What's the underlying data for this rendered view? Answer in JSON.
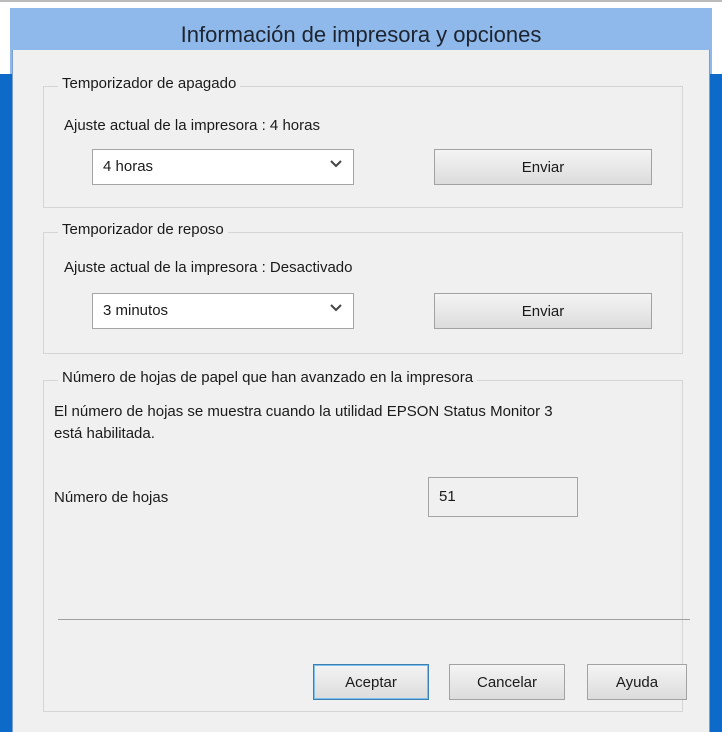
{
  "window": {
    "title": "Información de impresora y opciones"
  },
  "power_off": {
    "legend": "Temporizador de apagado",
    "current_setting": "Ajuste actual de la impresora : 4 horas",
    "selected": "4 horas",
    "send_label": "Enviar"
  },
  "sleep": {
    "legend": "Temporizador de reposo",
    "current_setting": "Ajuste actual de la impresora : Desactivado",
    "selected": "3 minutos",
    "send_label": "Enviar"
  },
  "sheets": {
    "legend": "Número de hojas de papel que han avanzado en la impresora",
    "description_line1": "El número de hojas se muestra cuando la utilidad EPSON Status Monitor 3",
    "description_line2": "está habilitada.",
    "count_label": "Número de hojas",
    "count_value": "51"
  },
  "footer": {
    "ok_label": "Aceptar",
    "cancel_label": "Cancelar",
    "help_label": "Ayuda"
  },
  "colors": {
    "accent_blue": "#0d6ac9",
    "titlebar": "#8fb9ea",
    "dialog_bg": "#f0f0f0"
  },
  "icons": {
    "dropdown": "chevron-down-icon"
  }
}
